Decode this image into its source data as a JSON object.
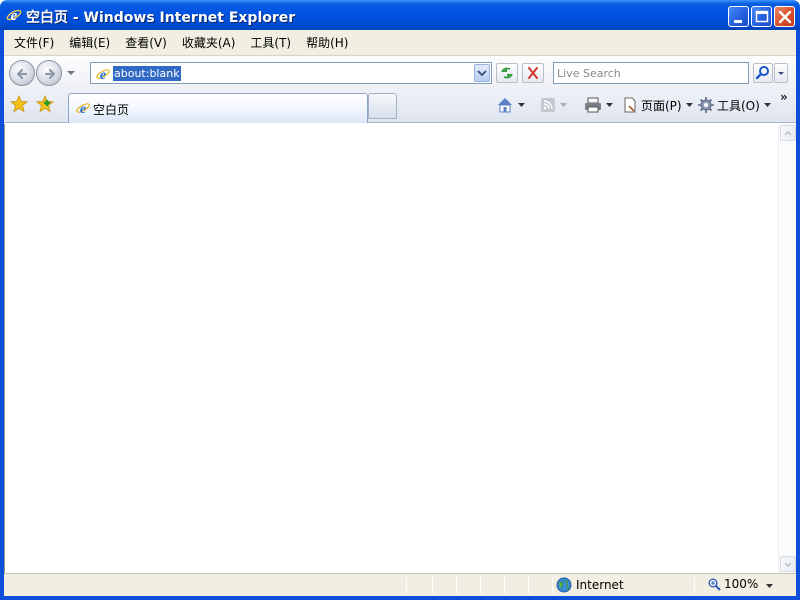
{
  "window": {
    "title": "空白页 - Windows Internet Explorer",
    "title_icon": "ie-icon",
    "controls": [
      "minimize",
      "maximize",
      "close"
    ]
  },
  "menubar": {
    "items": [
      {
        "label": "文件(F)"
      },
      {
        "label": "编辑(E)"
      },
      {
        "label": "查看(V)"
      },
      {
        "label": "收藏夹(A)"
      },
      {
        "label": "工具(T)"
      },
      {
        "label": "帮助(H)"
      }
    ]
  },
  "navigation": {
    "address": "about:blank",
    "search_placeholder": "Live Search"
  },
  "tabs": {
    "active_tab_label": "空白页"
  },
  "commandbar": {
    "page_label": "页面(P)",
    "tools_label": "工具(O)",
    "overflow": "»"
  },
  "statusbar": {
    "zone": "Internet",
    "zoom": "100%"
  },
  "colors": {
    "titlebar": "#0054e3",
    "menubar_bg": "#f1efe2",
    "selection": "#316ac5"
  }
}
